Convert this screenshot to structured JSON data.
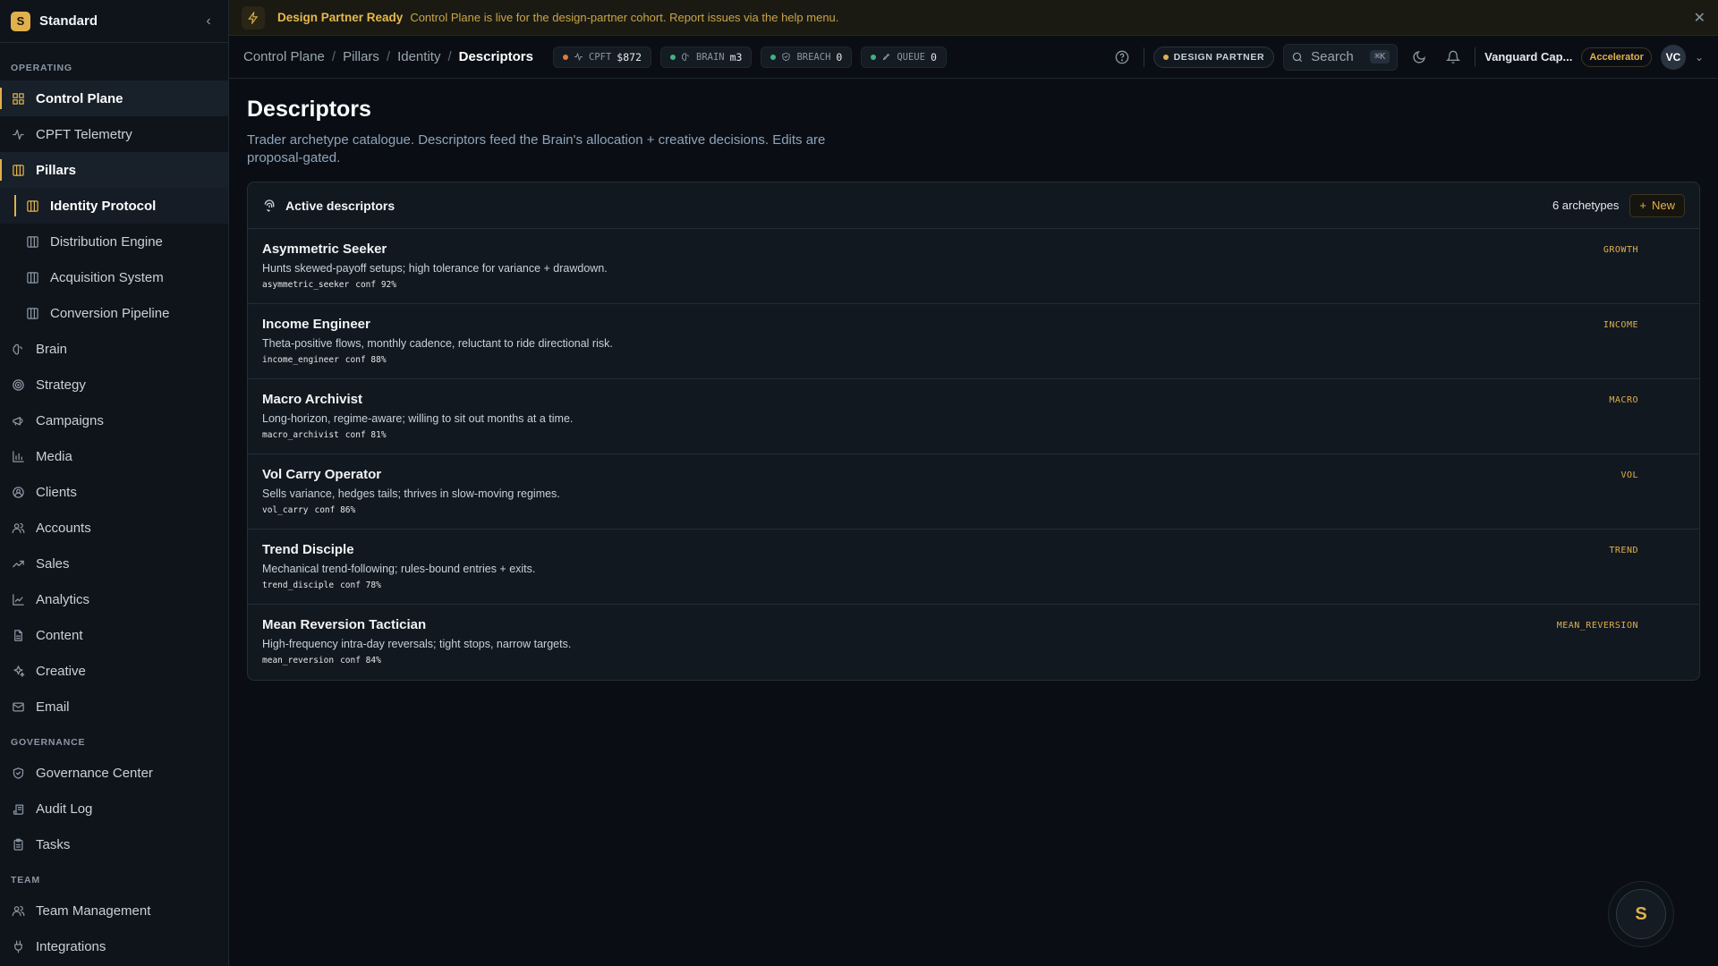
{
  "workspace": {
    "initial": "S",
    "name": "Standard"
  },
  "sidebar": {
    "sections": [
      {
        "label": "OPERATING",
        "items": [
          {
            "label": "Control Plane",
            "icon": "grid-icon",
            "active": true
          },
          {
            "label": "CPFT Telemetry",
            "icon": "activity-icon"
          },
          {
            "label": "Pillars",
            "icon": "columns-icon",
            "active": true
          },
          {
            "label": "Identity Protocol",
            "icon": "columns-icon",
            "sub": true,
            "active": true
          },
          {
            "label": "Distribution Engine",
            "icon": "columns-icon",
            "sub": true
          },
          {
            "label": "Acquisition System",
            "icon": "columns-icon",
            "sub": true
          },
          {
            "label": "Conversion Pipeline",
            "icon": "columns-icon",
            "sub": true
          },
          {
            "label": "Brain",
            "icon": "brain-icon"
          },
          {
            "label": "Strategy",
            "icon": "target-icon"
          },
          {
            "label": "Campaigns",
            "icon": "megaphone-icon"
          },
          {
            "label": "Media",
            "icon": "bar-chart-icon"
          },
          {
            "label": "Clients",
            "icon": "user-circle-icon"
          },
          {
            "label": "Accounts",
            "icon": "users-icon"
          },
          {
            "label": "Sales",
            "icon": "trending-up-icon"
          },
          {
            "label": "Analytics",
            "icon": "line-chart-icon"
          },
          {
            "label": "Content",
            "icon": "file-icon"
          },
          {
            "label": "Creative",
            "icon": "sparkles-icon"
          },
          {
            "label": "Email",
            "icon": "mail-icon"
          }
        ]
      },
      {
        "label": "GOVERNANCE",
        "items": [
          {
            "label": "Governance Center",
            "icon": "shield-icon"
          },
          {
            "label": "Audit Log",
            "icon": "scroll-icon"
          },
          {
            "label": "Tasks",
            "icon": "clipboard-icon"
          }
        ]
      },
      {
        "label": "TEAM",
        "items": [
          {
            "label": "Team Management",
            "icon": "users-icon"
          },
          {
            "label": "Integrations",
            "icon": "plug-icon"
          }
        ]
      }
    ]
  },
  "banner": {
    "title": "Design Partner Ready",
    "message": "Control Plane is live for the design-partner cohort. Report issues via the help menu."
  },
  "breadcrumbs": [
    "Control Plane",
    "Pillars",
    "Identity",
    "Descriptors"
  ],
  "metrics": [
    {
      "label": "CPFT",
      "value": "$872",
      "color": "#e07b3a",
      "icon": "activity-icon"
    },
    {
      "label": "BRAIN",
      "value": "m3",
      "color": "#3fb27f",
      "icon": "brain-icon"
    },
    {
      "label": "BREACH",
      "value": "0",
      "color": "#3fb27f",
      "icon": "shield-icon"
    },
    {
      "label": "QUEUE",
      "value": "0",
      "color": "#3fb27f",
      "icon": "rocket-icon"
    }
  ],
  "header": {
    "badge": "DESIGN PARTNER",
    "search_placeholder": "Search",
    "search_shortcut": "⌘K",
    "org_name": "Vanguard Cap...",
    "plan": "Accelerator",
    "avatar_initials": "VC"
  },
  "page": {
    "title": "Descriptors",
    "description": "Trader archetype catalogue. Descriptors feed the Brain's allocation + creative decisions. Edits are proposal-gated."
  },
  "card": {
    "title": "Active descriptors",
    "count_label": "6 archetypes",
    "new_label": "New",
    "rows": [
      {
        "name": "Asymmetric Seeker",
        "description": "Hunts skewed-payoff setups; high tolerance for variance + drawdown.",
        "key": "asymmetric_seeker",
        "conf": "conf 92%",
        "tag": "GROWTH"
      },
      {
        "name": "Income Engineer",
        "description": "Theta-positive flows, monthly cadence, reluctant to ride directional risk.",
        "key": "income_engineer",
        "conf": "conf 88%",
        "tag": "INCOME"
      },
      {
        "name": "Macro Archivist",
        "description": "Long-horizon, regime-aware; willing to sit out months at a time.",
        "key": "macro_archivist",
        "conf": "conf 81%",
        "tag": "MACRO"
      },
      {
        "name": "Vol Carry Operator",
        "description": "Sells variance, hedges tails; thrives in slow-moving regimes.",
        "key": "vol_carry",
        "conf": "conf 86%",
        "tag": "VOL"
      },
      {
        "name": "Trend Disciple",
        "description": "Mechanical trend-following; rules-bound entries + exits.",
        "key": "trend_disciple",
        "conf": "conf 78%",
        "tag": "TREND"
      },
      {
        "name": "Mean Reversion Tactician",
        "description": "High-frequency intra-day reversals; tight stops, narrow targets.",
        "key": "mean_reversion",
        "conf": "conf 84%",
        "tag": "MEAN_REVERSION"
      }
    ]
  },
  "fab": {
    "label": "S"
  },
  "colors": {
    "accent": "#e0b04a",
    "background": "#0a0e14",
    "sidebar": "#0f141b"
  }
}
